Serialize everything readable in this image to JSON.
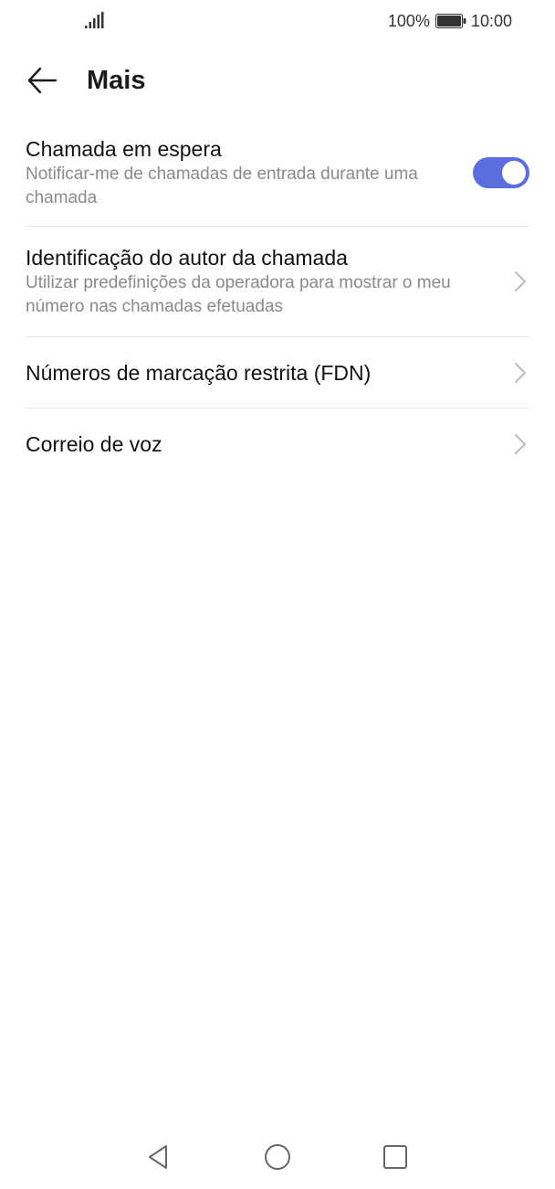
{
  "status_bar": {
    "signal_icon": "signal-icon",
    "battery_percent": "100%",
    "battery_icon": "battery-icon",
    "time": "10:00"
  },
  "app_bar": {
    "back_icon": "arrow-left-icon",
    "title": "Mais"
  },
  "settings": [
    {
      "title": "Chamada em espera",
      "subtitle": "Notificar-me de chamadas de entrada durante uma chamada",
      "control": "toggle",
      "toggle_on": true
    },
    {
      "title": "Identificação do autor da chamada",
      "subtitle": "Utilizar predefinições da operadora para mostrar o meu número nas chamadas efetuadas",
      "control": "chevron"
    },
    {
      "title": "Números de marcação restrita (FDN)",
      "control": "chevron"
    },
    {
      "title": "Correio de voz",
      "control": "chevron"
    }
  ],
  "nav_bar": {
    "back": "triangle-back-icon",
    "home": "circle-home-icon",
    "recent": "square-recent-icon"
  },
  "colors": {
    "accent": "#5a6ee0",
    "subtitle": "#8a8a8a",
    "divider": "#e6e6e6"
  }
}
